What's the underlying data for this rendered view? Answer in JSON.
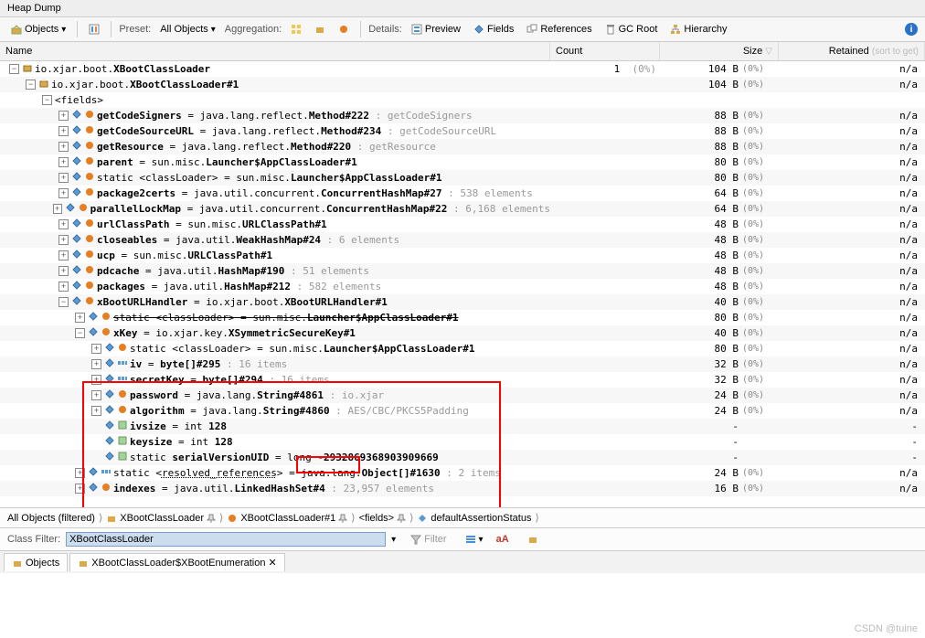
{
  "window": {
    "title": "Heap Dump"
  },
  "toolbar": {
    "objects": "Objects",
    "preset_lbl": "Preset:",
    "preset_val": "All Objects",
    "aggregation_lbl": "Aggregation:",
    "details_lbl": "Details:",
    "preview": "Preview",
    "fields": "Fields",
    "references": "References",
    "gcroot": "GC Root",
    "hierarchy": "Hierarchy"
  },
  "headers": {
    "name": "Name",
    "count": "Count",
    "size": "Size",
    "retained": "Retained",
    "retained_hint": "(sort to get)"
  },
  "tree": [
    {
      "d": 0,
      "e": "-",
      "icons": [
        "class"
      ],
      "parts": [
        [
          "io.xjar.boot.",
          0
        ],
        [
          "XBootClassLoader",
          1
        ]
      ],
      "count": "1",
      "cpct": "(0%)",
      "size": "104 B",
      "spct": "(0%)",
      "ret": "n/a"
    },
    {
      "d": 1,
      "e": "-",
      "icons": [
        "class"
      ],
      "parts": [
        [
          "io.xjar.boot.",
          0
        ],
        [
          "XBootClassLoader#1",
          1
        ]
      ],
      "size": "104 B",
      "spct": "(0%)",
      "ret": "n/a"
    },
    {
      "d": 2,
      "e": "-",
      "icons": [],
      "parts": [
        [
          "<fields>",
          0
        ]
      ]
    },
    {
      "d": 3,
      "e": "+",
      "icons": [
        "f",
        "obj"
      ],
      "parts": [
        [
          "getCodeSigners",
          1
        ],
        [
          " = ",
          0
        ],
        [
          "java.lang.reflect.",
          0
        ],
        [
          "Method#222",
          1
        ],
        [
          " : getCodeSigners",
          2
        ]
      ],
      "size": "88 B",
      "spct": "(0%)",
      "ret": "n/a"
    },
    {
      "d": 3,
      "e": "+",
      "icons": [
        "f",
        "obj"
      ],
      "parts": [
        [
          "getCodeSourceURL",
          1
        ],
        [
          " = ",
          0
        ],
        [
          "java.lang.reflect.",
          0
        ],
        [
          "Method#234",
          1
        ],
        [
          " : getCodeSourceURL",
          2
        ]
      ],
      "size": "88 B",
      "spct": "(0%)",
      "ret": "n/a"
    },
    {
      "d": 3,
      "e": "+",
      "icons": [
        "f",
        "obj"
      ],
      "parts": [
        [
          "getResource",
          1
        ],
        [
          " = ",
          0
        ],
        [
          "java.lang.reflect.",
          0
        ],
        [
          "Method#220",
          1
        ],
        [
          " : getResource",
          2
        ]
      ],
      "size": "88 B",
      "spct": "(0%)",
      "ret": "n/a"
    },
    {
      "d": 3,
      "e": "+",
      "icons": [
        "f",
        "obj"
      ],
      "parts": [
        [
          "parent",
          1
        ],
        [
          " = ",
          0
        ],
        [
          "sun.misc.",
          0
        ],
        [
          "Launcher$AppClassLoader#1",
          1
        ]
      ],
      "size": "80 B",
      "spct": "(0%)",
      "ret": "n/a"
    },
    {
      "d": 3,
      "e": "+",
      "icons": [
        "f",
        "obj"
      ],
      "parts": [
        [
          "static <classLoader>",
          0
        ],
        [
          " = ",
          0
        ],
        [
          "sun.misc.",
          0
        ],
        [
          "Launcher$AppClassLoader#1",
          1
        ]
      ],
      "size": "80 B",
      "spct": "(0%)",
      "ret": "n/a"
    },
    {
      "d": 3,
      "e": "+",
      "icons": [
        "f",
        "obj"
      ],
      "parts": [
        [
          "package2certs",
          1
        ],
        [
          " = ",
          0
        ],
        [
          "java.util.concurrent.",
          0
        ],
        [
          "ConcurrentHashMap#27",
          1
        ],
        [
          " : 538 elements",
          2
        ]
      ],
      "size": "64 B",
      "spct": "(0%)",
      "ret": "n/a"
    },
    {
      "d": 3,
      "e": "+",
      "icons": [
        "f",
        "obj"
      ],
      "parts": [
        [
          "parallelLockMap",
          1
        ],
        [
          " = ",
          0
        ],
        [
          "java.util.concurrent.",
          0
        ],
        [
          "ConcurrentHashMap#22",
          1
        ],
        [
          " : 6,168 elements",
          2
        ]
      ],
      "size": "64 B",
      "spct": "(0%)",
      "ret": "n/a"
    },
    {
      "d": 3,
      "e": "+",
      "icons": [
        "f",
        "obj"
      ],
      "parts": [
        [
          "urlClassPath",
          1
        ],
        [
          " = ",
          0
        ],
        [
          "sun.misc.",
          0
        ],
        [
          "URLClassPath#1",
          1
        ]
      ],
      "size": "48 B",
      "spct": "(0%)",
      "ret": "n/a"
    },
    {
      "d": 3,
      "e": "+",
      "icons": [
        "f",
        "obj"
      ],
      "parts": [
        [
          "closeables",
          1
        ],
        [
          " = ",
          0
        ],
        [
          "java.util.",
          0
        ],
        [
          "WeakHashMap#24",
          1
        ],
        [
          " : 6 elements",
          2
        ]
      ],
      "size": "48 B",
      "spct": "(0%)",
      "ret": "n/a"
    },
    {
      "d": 3,
      "e": "+",
      "icons": [
        "f",
        "obj"
      ],
      "parts": [
        [
          "ucp",
          1
        ],
        [
          " = ",
          0
        ],
        [
          "sun.misc.",
          0
        ],
        [
          "URLClassPath#1",
          1
        ]
      ],
      "size": "48 B",
      "spct": "(0%)",
      "ret": "n/a"
    },
    {
      "d": 3,
      "e": "+",
      "icons": [
        "f",
        "obj"
      ],
      "parts": [
        [
          "pdcache",
          1
        ],
        [
          " = ",
          0
        ],
        [
          "java.util.",
          0
        ],
        [
          "HashMap#190",
          1
        ],
        [
          " : 51 elements",
          2
        ]
      ],
      "size": "48 B",
      "spct": "(0%)",
      "ret": "n/a"
    },
    {
      "d": 3,
      "e": "+",
      "icons": [
        "f",
        "obj"
      ],
      "parts": [
        [
          "packages",
          1
        ],
        [
          " = ",
          0
        ],
        [
          "java.util.",
          0
        ],
        [
          "HashMap#212",
          1
        ],
        [
          " : 582 elements",
          2
        ]
      ],
      "size": "48 B",
      "spct": "(0%)",
      "ret": "n/a"
    },
    {
      "d": 3,
      "e": "-",
      "icons": [
        "f",
        "obj"
      ],
      "parts": [
        [
          "xBootURLHandler",
          1
        ],
        [
          " = ",
          0
        ],
        [
          "io.xjar.boot.",
          0
        ],
        [
          "XBootURLHandler#1",
          1
        ]
      ],
      "size": "40 B",
      "spct": "(0%)",
      "ret": "n/a"
    },
    {
      "d": 4,
      "e": "+",
      "icons": [
        "f",
        "obj"
      ],
      "strike": true,
      "parts": [
        [
          "static <classLoader>",
          0
        ],
        [
          " = ",
          0
        ],
        [
          "sun.misc.",
          0
        ],
        [
          "Launcher$AppClassLoader#1",
          1
        ]
      ],
      "size": "80 B",
      "spct": "(0%)",
      "ret": "n/a"
    },
    {
      "d": 4,
      "e": "-",
      "icons": [
        "f",
        "obj"
      ],
      "parts": [
        [
          "xKey",
          1
        ],
        [
          " = ",
          0
        ],
        [
          "io.xjar.key.",
          0
        ],
        [
          "XSymmetricSecureKey#1",
          1
        ]
      ],
      "size": "40 B",
      "spct": "(0%)",
      "ret": "n/a"
    },
    {
      "d": 5,
      "e": "+",
      "icons": [
        "f",
        "obj"
      ],
      "parts": [
        [
          "static <classLoader>",
          0
        ],
        [
          " = ",
          0
        ],
        [
          "sun.misc.",
          0
        ],
        [
          "Launcher$AppClassLoader#1",
          1
        ]
      ],
      "size": "80 B",
      "spct": "(0%)",
      "ret": "n/a"
    },
    {
      "d": 5,
      "e": "+",
      "icons": [
        "f",
        "arr"
      ],
      "parts": [
        [
          "iv",
          1
        ],
        [
          " = ",
          0
        ],
        [
          "byte[]#295",
          1
        ],
        [
          " : 16 items",
          2
        ]
      ],
      "size": "32 B",
      "spct": "(0%)",
      "ret": "n/a"
    },
    {
      "d": 5,
      "e": "+",
      "icons": [
        "f",
        "arr"
      ],
      "parts": [
        [
          "secretKey",
          1
        ],
        [
          " = ",
          0
        ],
        [
          "byte[]#294",
          1
        ],
        [
          " : 16 items",
          2
        ]
      ],
      "size": "32 B",
      "spct": "(0%)",
      "ret": "n/a"
    },
    {
      "d": 5,
      "e": "+",
      "icons": [
        "f",
        "obj"
      ],
      "parts": [
        [
          "password",
          1
        ],
        [
          " = ",
          0
        ],
        [
          "java.lang.",
          0
        ],
        [
          "String#4861",
          1
        ],
        [
          " : io.xjar",
          2
        ]
      ],
      "size": "24 B",
      "spct": "(0%)",
      "ret": "n/a"
    },
    {
      "d": 5,
      "e": "+",
      "icons": [
        "f",
        "obj"
      ],
      "parts": [
        [
          "algorithm",
          1
        ],
        [
          " = ",
          0
        ],
        [
          "java.lang.",
          0
        ],
        [
          "String#4860",
          1
        ],
        [
          " : AES/CBC/PKCS5Padding",
          2
        ]
      ],
      "size": "24 B",
      "spct": "(0%)",
      "ret": "n/a"
    },
    {
      "d": 5,
      "e": "",
      "icons": [
        "f",
        "prim"
      ],
      "parts": [
        [
          "ivsize",
          1
        ],
        [
          " = ",
          0
        ],
        [
          "int ",
          0
        ],
        [
          "128",
          1
        ]
      ],
      "size": "-",
      "ret": "-"
    },
    {
      "d": 5,
      "e": "",
      "icons": [
        "f",
        "prim"
      ],
      "parts": [
        [
          "keysize",
          1
        ],
        [
          " = ",
          0
        ],
        [
          "int ",
          0
        ],
        [
          "128",
          1
        ]
      ],
      "size": "-",
      "ret": "-"
    },
    {
      "d": 5,
      "e": "",
      "icons": [
        "f",
        "prim"
      ],
      "parts": [
        [
          "static ",
          0
        ],
        [
          "serialVersionUID",
          1
        ],
        [
          " = ",
          0
        ],
        [
          "long ",
          0
        ],
        [
          "-2932869368903909669",
          1
        ]
      ],
      "size": "-",
      "ret": "-"
    },
    {
      "d": 4,
      "e": "+",
      "icons": [
        "f",
        "arr"
      ],
      "parts": [
        [
          "static <",
          0
        ],
        [
          "resolved_references",
          3
        ],
        [
          ">",
          0
        ],
        [
          " = ",
          0
        ],
        [
          "java.lang.",
          0
        ],
        [
          "Object[]#1630",
          1
        ],
        [
          " : 2 items",
          2
        ]
      ],
      "size": "24 B",
      "spct": "(0%)",
      "ret": "n/a"
    },
    {
      "d": 4,
      "e": "+",
      "icons": [
        "f",
        "obj"
      ],
      "parts": [
        [
          "indexes",
          1
        ],
        [
          " = ",
          0
        ],
        [
          "java.util.",
          0
        ],
        [
          "LinkedHashSet#4",
          1
        ],
        [
          " : 23,957 elements",
          2
        ]
      ],
      "size": "16 B",
      "spct": "(0%)",
      "ret": "n/a"
    }
  ],
  "breadcrumb": {
    "pre": "All Objects (filtered)",
    "items": [
      "XBootClassLoader",
      "XBootClassLoader#1",
      "<fields>",
      "defaultAssertionStatus"
    ]
  },
  "filter": {
    "label": "Class Filter:",
    "value": "XBootClassLoader",
    "filter_lbl": "Filter"
  },
  "tabs": {
    "t1": "Objects",
    "t2": "XBootClassLoader$XBootEnumeration"
  },
  "watermark": "CSDN @tuine"
}
